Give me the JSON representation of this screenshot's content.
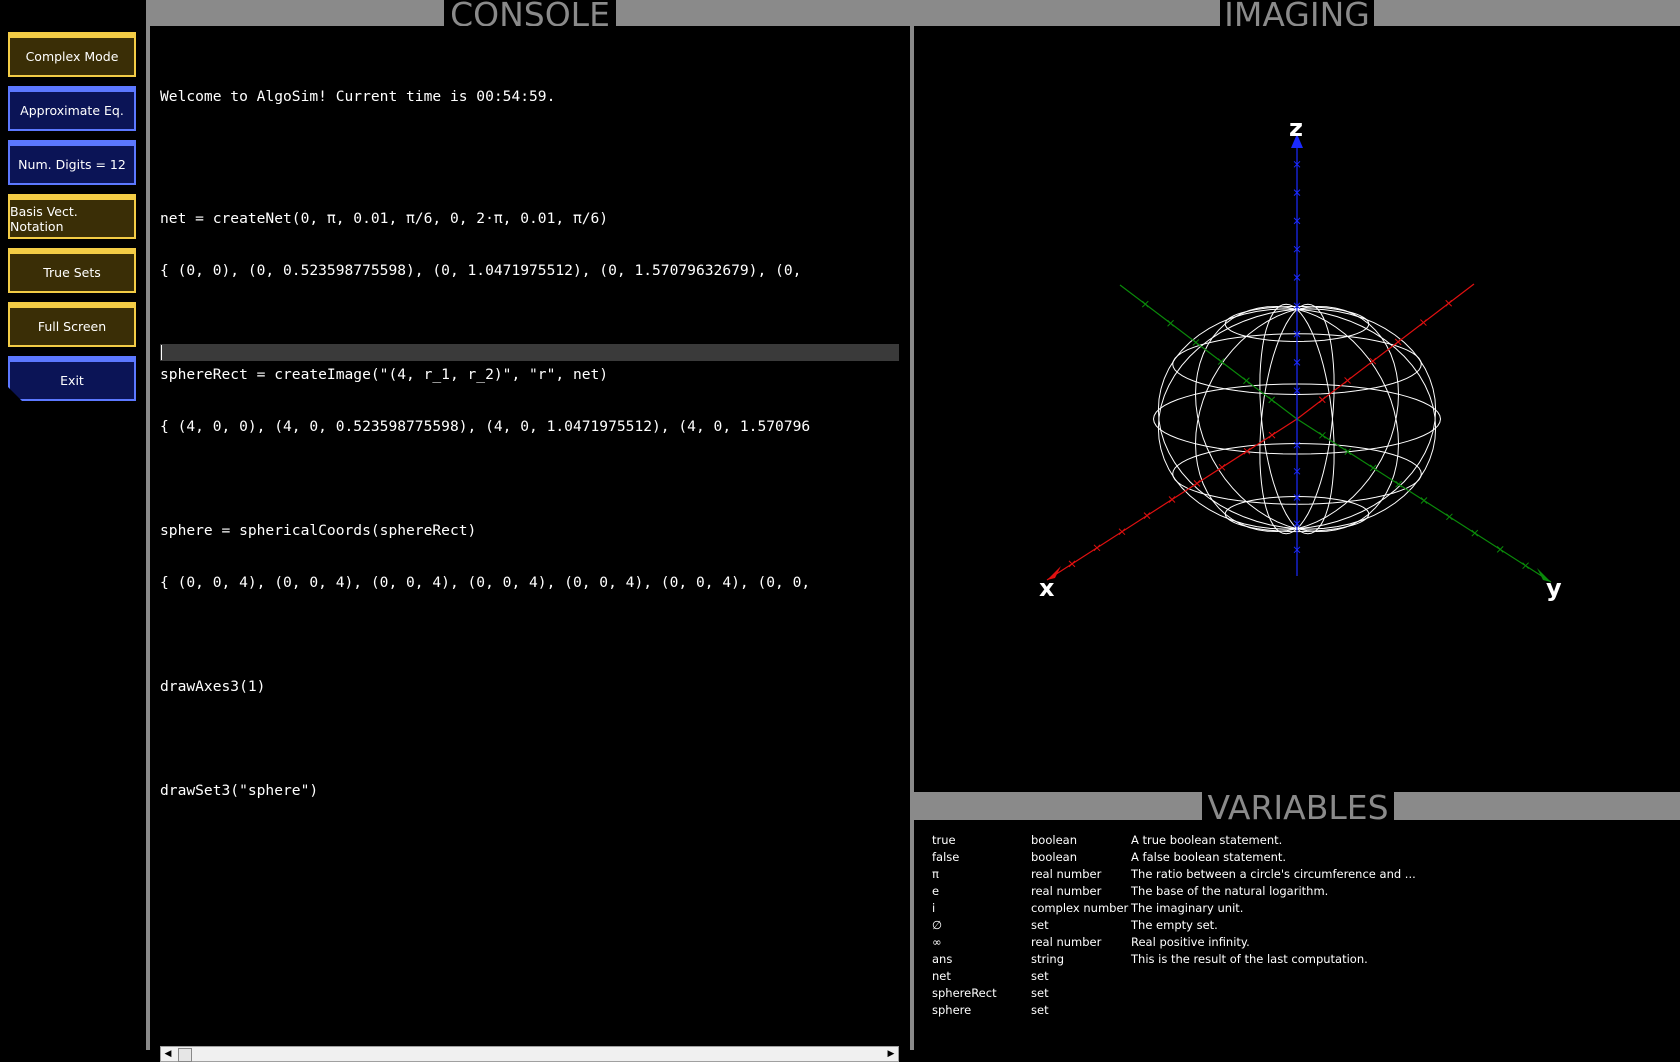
{
  "headers": {
    "console": "CONSOLE",
    "imaging": "IMAGING",
    "variables": "VARIABLES"
  },
  "buttons": [
    {
      "label": "Complex Mode",
      "style": "gold"
    },
    {
      "label": "Approximate Eq.",
      "style": "blue"
    },
    {
      "label": "Num. Digits = 12",
      "style": "blue"
    },
    {
      "label": "Basis Vect. Notation",
      "style": "gold"
    },
    {
      "label": "True Sets",
      "style": "gold"
    },
    {
      "label": "Full Screen",
      "style": "gold"
    },
    {
      "label": "Exit",
      "style": "blue"
    }
  ],
  "console": {
    "welcome": "Welcome to AlgoSim! Current time is 00:54:59.",
    "cmd1": "net = createNet(0, π, 0.01, π/6, 0, 2·π, 0.01, π/6)",
    "out1": "{ (0, 0), (0, 0.523598775598), (0, 1.0471975512), (0, 1.57079632679), (0,",
    "cmd2": "sphereRect = createImage(\"(4, r_1, r_2)\", \"r\", net)",
    "out2": "{ (4, 0, 0), (4, 0, 0.523598775598), (4, 0, 1.0471975512), (4, 0, 1.570796",
    "cmd3": "sphere = sphericalCoords(sphereRect)",
    "out3": "{ (0, 0, 4), (0, 0, 4), (0, 0, 4), (0, 0, 4), (0, 0, 4), (0, 0, 4), (0, 0,",
    "cmd4": "drawAxes3(1)",
    "cmd5": "drawSet3(\"sphere\")",
    "input_value": ""
  },
  "axes": {
    "x": "x",
    "y": "y",
    "z": "z",
    "x_color": "#e01010",
    "y_color": "#0a8a0a",
    "z_color": "#1a2aff"
  },
  "variables": [
    {
      "name": "true",
      "type": "boolean",
      "desc": "A true boolean statement."
    },
    {
      "name": "false",
      "type": "boolean",
      "desc": "A false boolean statement."
    },
    {
      "name": "π",
      "type": "real number",
      "desc": "The ratio between a circle's circumference and ..."
    },
    {
      "name": "e",
      "type": "real number",
      "desc": "The base of the natural logarithm."
    },
    {
      "name": "i",
      "type": "complex number",
      "desc": "The imaginary unit."
    },
    {
      "name": "∅",
      "type": "set",
      "desc": "The empty set."
    },
    {
      "name": "∞",
      "type": "real number",
      "desc": "Real positive infinity."
    },
    {
      "name": "ans",
      "type": "string",
      "desc": "This is the result of the last computation."
    },
    {
      "name": "net",
      "type": "set",
      "desc": ""
    },
    {
      "name": "sphereRect",
      "type": "set",
      "desc": ""
    },
    {
      "name": "sphere",
      "type": "set",
      "desc": ""
    }
  ]
}
